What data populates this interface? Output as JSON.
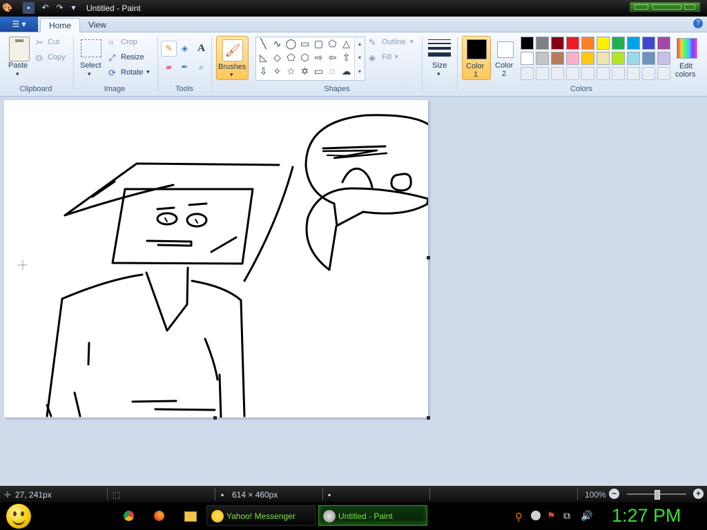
{
  "window": {
    "title": "Untitled - Paint"
  },
  "tabs": [
    {
      "label": "Home"
    },
    {
      "label": "View"
    }
  ],
  "clipboard": {
    "paste": "Paste",
    "cut": "Cut",
    "copy": "Copy",
    "label": "Clipboard"
  },
  "image": {
    "select": "Select",
    "crop": "Crop",
    "resize": "Resize",
    "rotate": "Rotate",
    "label": "Image"
  },
  "tools": {
    "label": "Tools",
    "text_tool": "A"
  },
  "brushes": {
    "label": "Brushes"
  },
  "shapes": {
    "outline": "Outline",
    "fill": "Fill",
    "label": "Shapes"
  },
  "size": {
    "label": "Size"
  },
  "colors": {
    "color1_label": "Color 1",
    "color1_line1": "Color",
    "color1_line2": "1",
    "color2_line1": "Color",
    "color2_line2": "2",
    "color1": "#000000",
    "color2": "#ffffff",
    "edit_line1": "Edit",
    "edit_line2": "colors",
    "label": "Colors",
    "palette_row1": [
      "#000000",
      "#7f7f7f",
      "#880015",
      "#ed1c24",
      "#ff7f27",
      "#fff200",
      "#22b14c",
      "#00a2e8",
      "#3f48cc",
      "#a349a4"
    ],
    "palette_row2": [
      "#ffffff",
      "#c3c3c3",
      "#b97a57",
      "#ffaec9",
      "#ffc90e",
      "#efe4b0",
      "#b5e61d",
      "#99d9ea",
      "#7092be",
      "#c8bfe7"
    ]
  },
  "status": {
    "cursor_pos": "27, 241px",
    "canvas_size": "614 × 460px",
    "zoom": "100%"
  },
  "taskbar": {
    "apps": [
      {
        "label": "Yahoo! Messenger"
      },
      {
        "label": "Untitled - Paint"
      }
    ],
    "clock": "1:27 PM"
  }
}
